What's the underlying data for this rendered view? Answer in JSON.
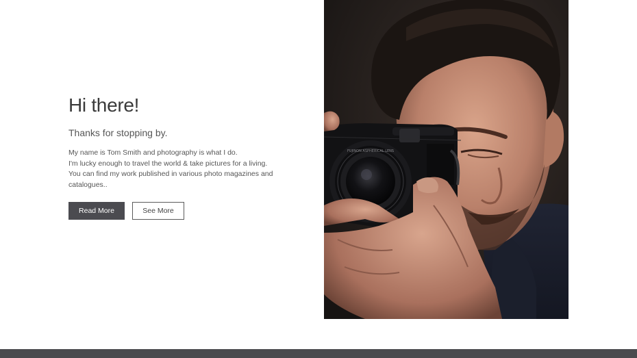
{
  "intro": {
    "heading": "Hi there!",
    "subheading": "Thanks for stopping by.",
    "bio_lines": [
      "My name is Tom Smith and photography is what I do.",
      "I'm lucky enough to travel the world & take pictures for a living.",
      "You can find my work published in various photo magazines and",
      "catalogues.."
    ]
  },
  "actions": {
    "read_more_label": "Read More",
    "see_more_label": "See More"
  },
  "photo": {
    "camera_lens_text": "FUJINON ASPHERICAL LENS"
  },
  "colors": {
    "primary_button": "#4b4b50",
    "footer_bar": "#4a4a4e"
  }
}
